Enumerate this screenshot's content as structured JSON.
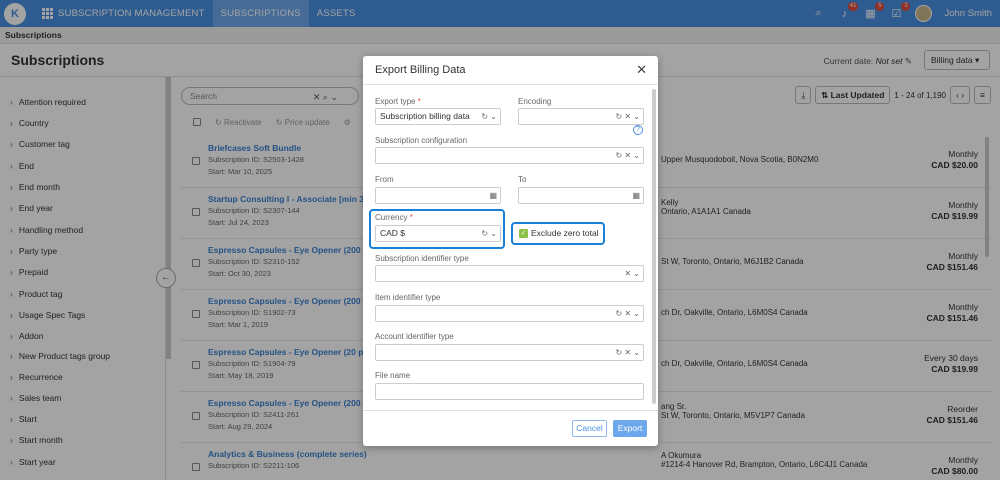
{
  "nav": {
    "brand": "SUBSCRIPTION MANAGEMENT",
    "tabs": [
      "SUBSCRIPTIONS",
      "ASSETS"
    ],
    "badges": [
      "41",
      "5",
      "3"
    ],
    "user": "John Smith"
  },
  "breadcrumb": "Subscriptions",
  "page": {
    "title": "Subscriptions",
    "current_date_label": "Current date:",
    "current_date_value": "Not set",
    "billing_button": "Billing data"
  },
  "filters": [
    "Attention required",
    "Country",
    "Customer tag",
    "End",
    "End month",
    "End year",
    "Handling method",
    "Party type",
    "Prepaid",
    "Product tag",
    "Usage Spec Tags",
    "Addon",
    "New Product tags group",
    "Recurrence",
    "Sales team",
    "Start",
    "Start month",
    "Start year"
  ],
  "list": {
    "search_placeholder": "Search",
    "toolbar": [
      "Reactivate",
      "Price update"
    ],
    "sort_label": "Last Updated",
    "pager": "1 - 24 of 1,190",
    "rows": [
      {
        "name": "Briefcases Soft Bundle",
        "sid": "Subscription ID: S2503-1428",
        "start": "Start: Mar 10, 2025",
        "addr": "Upper Musquodoboit, Nova Scotia, B0N2M0",
        "freq": "Monthly",
        "price": "CAD $20.00"
      },
      {
        "name": "Startup Consulting I - Associate [min 3 da",
        "sid": "Subscription ID: S2307-144",
        "start": "Start: Jul 24, 2023",
        "addr": "Kelly\nOntario, A1A1A1 Canada",
        "freq": "Monthly",
        "price": "CAD $19.99"
      },
      {
        "name": "Espresso Capsules - Eye Opener (200 pod",
        "sid": "Subscription ID: S2310-152",
        "start": "Start: Oct 30, 2023",
        "addr": "St W, Toronto, Ontario, M6J1B2 Canada",
        "freq": "Monthly",
        "price": "CAD $151.46"
      },
      {
        "name": "Espresso Capsules - Eye Opener (200 pod",
        "sid": "Subscription ID: S1902-73",
        "start": "Start: Mar 1, 2019",
        "addr": "ch Dr, Oakville, Ontario, L6M0S4 Canada",
        "freq": "Monthly",
        "price": "CAD $151.46"
      },
      {
        "name": "Espresso Capsules - Eye Opener (20 pods",
        "sid": "Subscription ID: S1904-79",
        "start": "Start: May 18, 2019",
        "addr": "ch Dr, Oakville, Ontario, L6M0S4 Canada",
        "freq": "Every 30 days",
        "price": "CAD $19.99"
      },
      {
        "name": "Espresso Capsules - Eye Opener (200 pod",
        "sid": "Subscription ID: S2411-261",
        "start": "Start: Aug 29, 2024",
        "addr": "ang Sr.\nSt W, Toronto, Ontario, M5V1P7 Canada",
        "freq": "Reorder",
        "price": "CAD $151.46"
      },
      {
        "name": "Analytics & Business (complete series)",
        "sid": "Subscription ID: S2211-106",
        "start": "",
        "addr": "A Okumura\n#1214-4 Hanover Rd, Brampton, Ontario, L6C4J1 Canada",
        "freq": "Monthly",
        "price": "CAD $80.00"
      }
    ]
  },
  "modal": {
    "title": "Export Billing Data",
    "export_type_label": "Export type",
    "export_type_value": "Subscription billing data",
    "encoding_label": "Encoding",
    "sub_config_label": "Subscription configuration",
    "from_label": "From",
    "to_label": "To",
    "currency_label": "Currency",
    "currency_value": "CAD $",
    "exclude_label": "Exclude zero total",
    "sub_id_type_label": "Subscription identifier type",
    "item_id_type_label": "Item identifier type",
    "account_id_type_label": "Account identifier type",
    "file_name_label": "File name",
    "cancel": "Cancel",
    "export": "Export"
  }
}
